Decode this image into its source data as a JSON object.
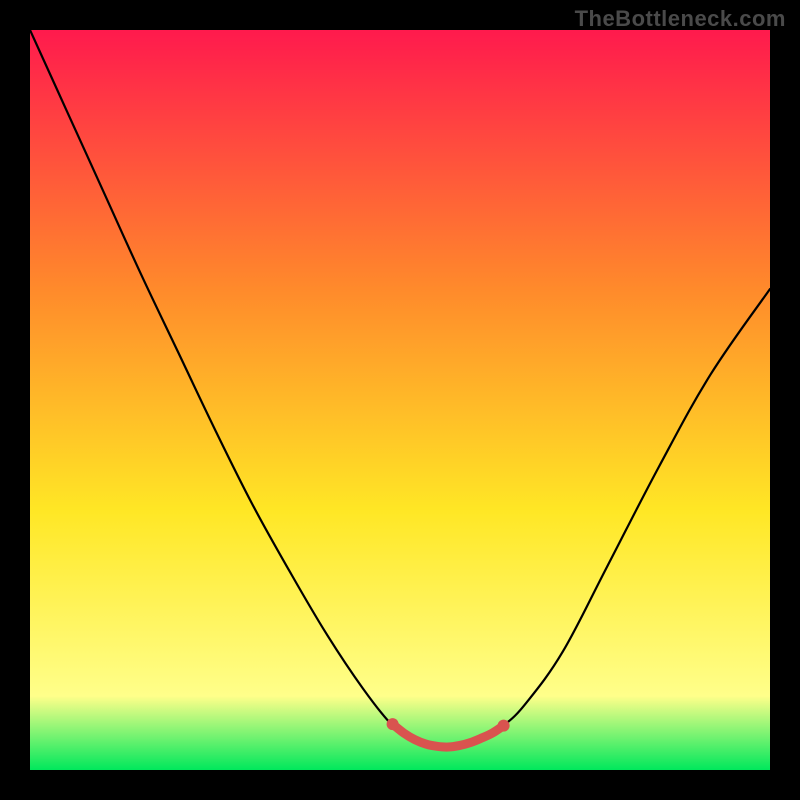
{
  "watermark": "TheBottleneck.com",
  "chart_data": {
    "type": "line",
    "title": "",
    "xlabel": "",
    "ylabel": "",
    "xlim": [
      0,
      100
    ],
    "ylim": [
      0,
      100
    ],
    "grid": false,
    "background_gradient": {
      "top": "#ff1a4d",
      "mid1": "#ff8a2b",
      "mid2": "#ffe725",
      "mid3": "#ffff8a",
      "bottom": "#00e85c"
    },
    "series": [
      {
        "name": "curve",
        "color": "#000000",
        "x": [
          0,
          5,
          10,
          15,
          20,
          25,
          30,
          35,
          40,
          45,
          49,
          52,
          55,
          58,
          61,
          64,
          67,
          72,
          78,
          85,
          92,
          100
        ],
        "y": [
          100,
          89,
          78,
          67,
          56.5,
          46,
          36,
          27,
          18.5,
          11,
          6,
          4,
          3,
          3,
          4,
          6,
          9,
          16,
          27.5,
          41,
          53.5,
          65
        ]
      },
      {
        "name": "bottom-marker",
        "color": "#d9534f",
        "x": [
          49,
          50.5,
          52,
          53.5,
          55,
          56.5,
          58,
          59.5,
          61,
          62.5,
          64
        ],
        "y": [
          6.2,
          5.0,
          4.1,
          3.5,
          3.2,
          3.1,
          3.3,
          3.7,
          4.3,
          5.0,
          6.0
        ]
      }
    ]
  }
}
